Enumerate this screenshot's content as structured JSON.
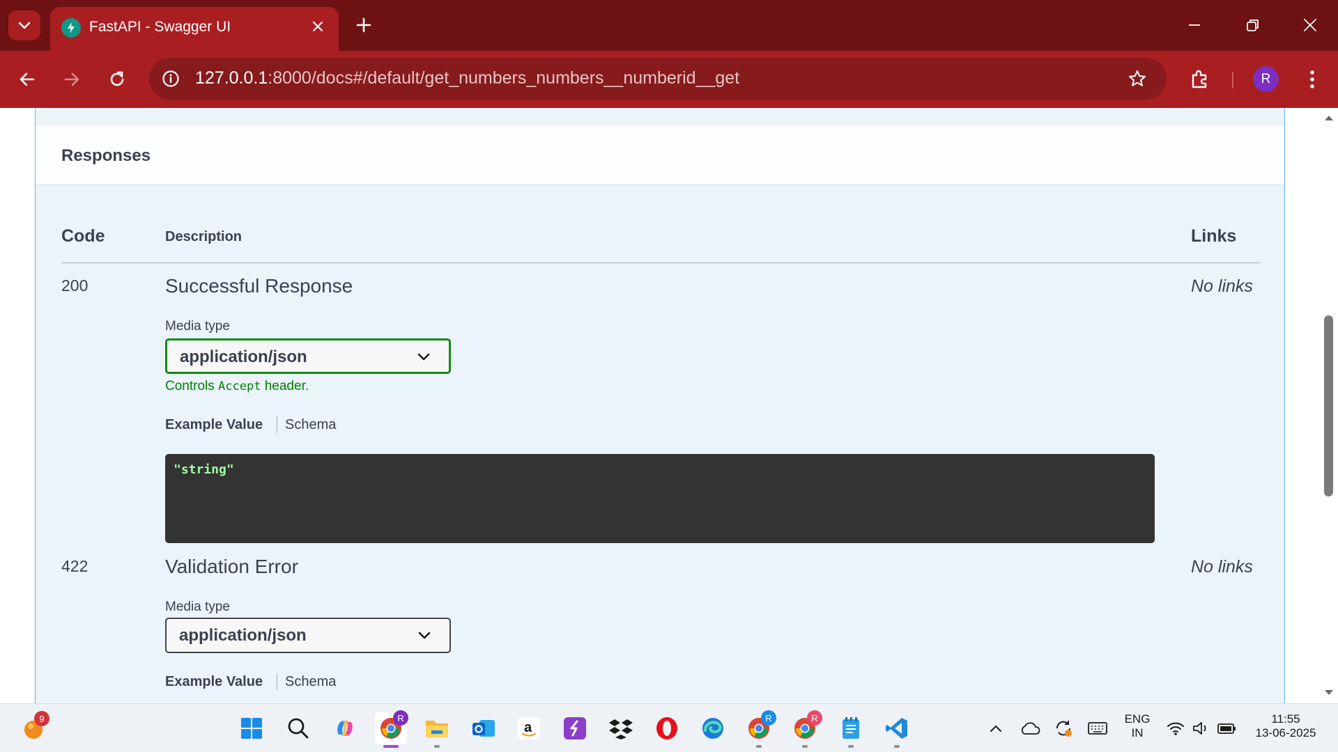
{
  "browser": {
    "tab_title": "FastAPI - Swagger UI",
    "url_host": "127.0.0.1",
    "url_rest": ":8000/docs#/default/get_numbers_numbers__numberid__get",
    "profile_initial": "R"
  },
  "responses": {
    "title": "Responses",
    "columns": {
      "code": "Code",
      "description": "Description",
      "links": "Links"
    },
    "items": [
      {
        "code": "200",
        "description": "Successful Response",
        "links": "No links",
        "media_type_label": "Media type",
        "media_type": "application/json",
        "controls_prefix": "Controls ",
        "controls_code": "Accept",
        "controls_suffix": " header.",
        "example_tab": "Example Value",
        "schema_tab": "Schema",
        "example": "\"string\""
      },
      {
        "code": "422",
        "description": "Validation Error",
        "links": "No links",
        "media_type_label": "Media type",
        "media_type": "application/json",
        "example_tab": "Example Value",
        "schema_tab": "Schema"
      }
    ]
  },
  "taskbar": {
    "notification_count": "9",
    "chrome_profile_badge": "R",
    "language": "ENG",
    "region": "IN",
    "time": "11:55",
    "date": "13-06-2025"
  },
  "colors": {
    "browser_frame": "#6e1213",
    "browser_toolbar": "#a81e21",
    "get_accent": "#61affe",
    "active_select_border": "#118a11",
    "code_background": "#333333",
    "code_text": "#a2fca2"
  }
}
